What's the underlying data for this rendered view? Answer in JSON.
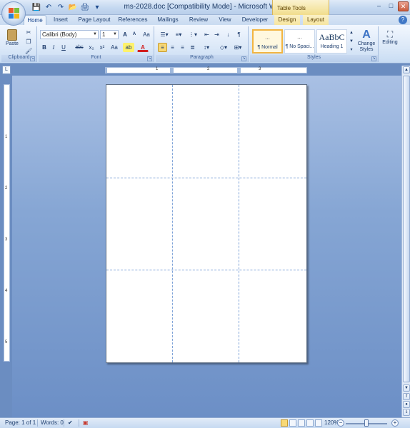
{
  "window": {
    "title": "ms-2028.doc [Compatibility Mode] - Microsoft Word",
    "context_tab_group": "Table Tools",
    "minimize": "–",
    "maximize": "□",
    "close": "✕"
  },
  "qat": {
    "save": "💾",
    "undo": "↶",
    "redo": "↷",
    "open": "📂",
    "print": "🖨",
    "more": "▾"
  },
  "tabs": [
    "Home",
    "Insert",
    "Page Layout",
    "References",
    "Mailings",
    "Review",
    "View",
    "Developer",
    "Design",
    "Layout"
  ],
  "ribbon": {
    "clipboard": {
      "label": "Clipboard",
      "paste": "Paste"
    },
    "font": {
      "label": "Font",
      "family": "Calibri (Body)",
      "size": "1",
      "grow": "A",
      "shrink": "A",
      "clear": "Aa",
      "bold": "B",
      "italic": "I",
      "underline": "U",
      "strike": "abc",
      "sub": "x₂",
      "sup": "x²",
      "case": "Aa",
      "highlight": "ab",
      "color": "A"
    },
    "paragraph": {
      "label": "Paragraph"
    },
    "styles": {
      "label": "Styles",
      "cards": [
        {
          "preview": "...",
          "name": "¶ Normal"
        },
        {
          "preview": "...",
          "name": "¶ No Spaci..."
        },
        {
          "preview": "AaBbC",
          "name": "Heading 1"
        }
      ],
      "change_styles": "Change Styles"
    },
    "editing": {
      "label": "Editing"
    }
  },
  "ruler": {
    "h_numbers": [
      "1",
      "2",
      "3"
    ],
    "v_numbers": [
      "1",
      "2",
      "3",
      "4",
      "5"
    ]
  },
  "status": {
    "page": "Page: 1 of 1",
    "words": "Words: 0",
    "zoom": "120%",
    "zoom_out": "−",
    "zoom_in": "+"
  },
  "colors": {
    "ribbon": "#dbe8f8",
    "workspace": "#86a6d4",
    "gridlines": "#7fa3d8",
    "selected_style": "#f2b542"
  }
}
